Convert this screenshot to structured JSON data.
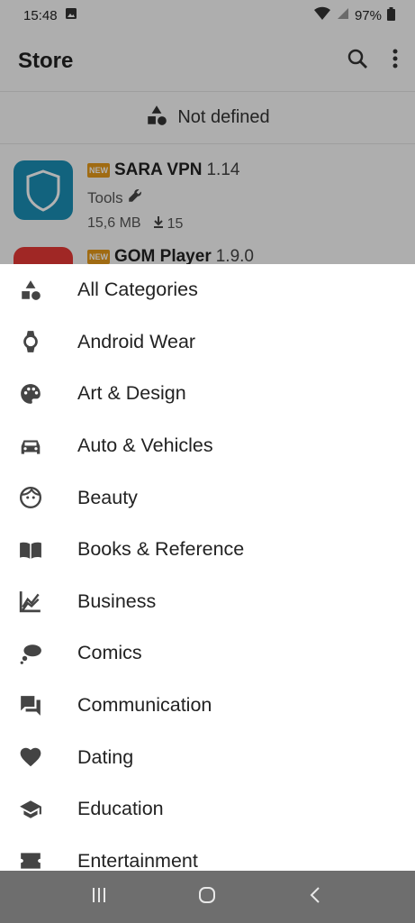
{
  "status_bar": {
    "time": "15:48",
    "battery": "97%"
  },
  "app_bar": {
    "title": "Store"
  },
  "filter": {
    "label": "Not defined"
  },
  "apps": [
    {
      "name": "SARA VPN",
      "version": "1.14",
      "badge": "NEW",
      "category": "Tools",
      "size": "15,6 MB",
      "downloads": "15",
      "icon_color": "#1b8fb5"
    },
    {
      "name": "GOM Player",
      "version": "1.9.0",
      "badge": "NEW",
      "icon_color": "#e53935"
    }
  ],
  "categories": [
    {
      "label": "All Categories",
      "icon": "shapes-icon"
    },
    {
      "label": "Android Wear",
      "icon": "watch-icon"
    },
    {
      "label": "Art & Design",
      "icon": "palette-icon"
    },
    {
      "label": "Auto & Vehicles",
      "icon": "car-icon"
    },
    {
      "label": "Beauty",
      "icon": "face-icon"
    },
    {
      "label": "Books & Reference",
      "icon": "book-icon"
    },
    {
      "label": "Business",
      "icon": "chart-icon"
    },
    {
      "label": "Comics",
      "icon": "thought-bubble-icon"
    },
    {
      "label": "Communication",
      "icon": "chat-icon"
    },
    {
      "label": "Dating",
      "icon": "heart-icon"
    },
    {
      "label": "Education",
      "icon": "school-icon"
    },
    {
      "label": "Entertainment",
      "icon": "ticket-icon"
    }
  ]
}
